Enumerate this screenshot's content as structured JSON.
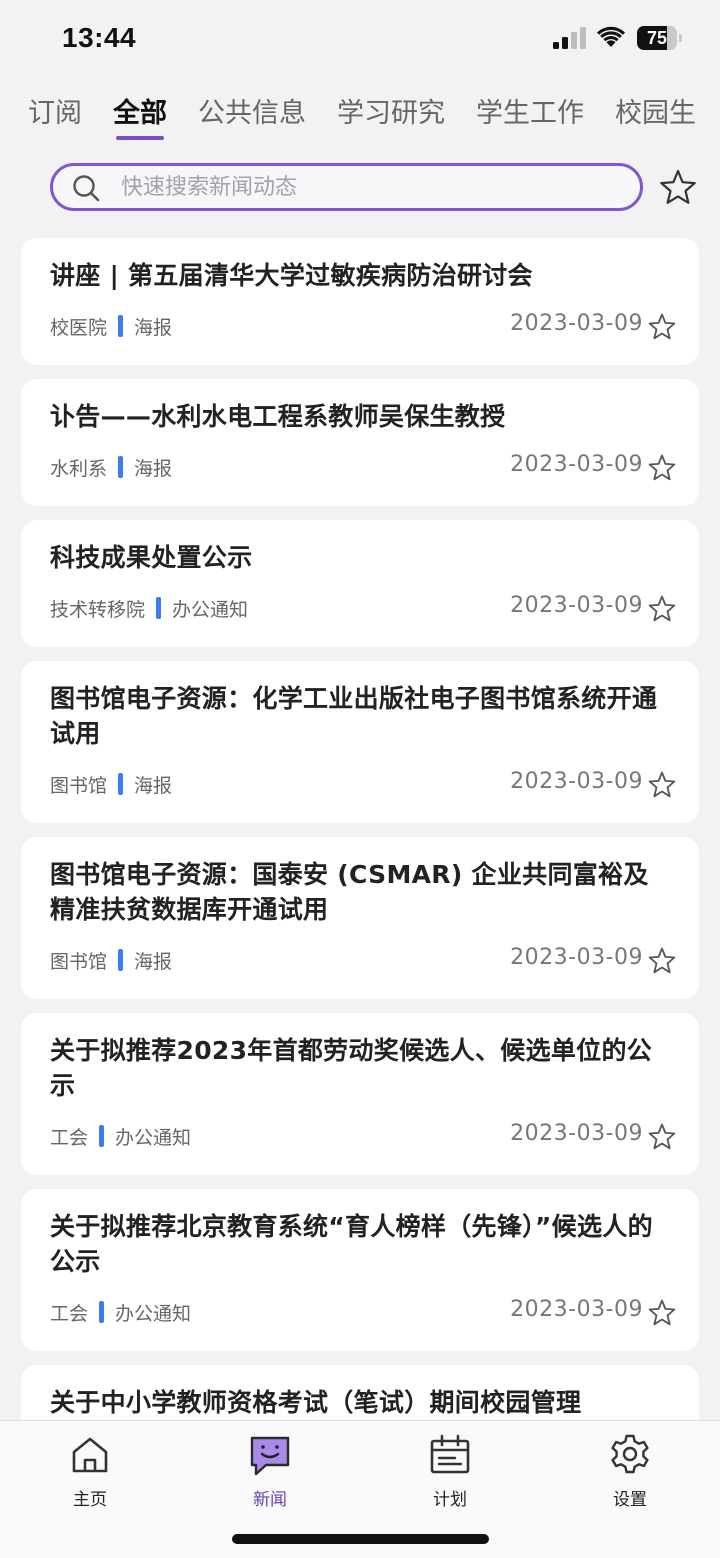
{
  "status": {
    "time": "13:44",
    "battery": "75",
    "battery_level": 0.75
  },
  "tabs": [
    "订阅",
    "全部",
    "公共信息",
    "学习研究",
    "学生工作",
    "校园生"
  ],
  "active_tab": 1,
  "search": {
    "placeholder": "快速搜索新闻动态"
  },
  "news": [
    {
      "title": "讲座 | 第五届清华大学过敏疾病防治研讨会",
      "source": "校医院",
      "type": "海报",
      "date": "2023-03-09"
    },
    {
      "title": "讣告——水利水电工程系教师吴保生教授",
      "source": "水利系",
      "type": "海报",
      "date": "2023-03-09"
    },
    {
      "title": "科技成果处置公示",
      "source": "技术转移院",
      "type": "办公通知",
      "date": "2023-03-09"
    },
    {
      "title": "图书馆电子资源：化学工业出版社电子图书馆系统开通试用",
      "source": "图书馆",
      "type": "海报",
      "date": "2023-03-09"
    },
    {
      "title": "图书馆电子资源：国泰安 (CSMAR) 企业共同富裕及精准扶贫数据库开通试用",
      "source": "图书馆",
      "type": "海报",
      "date": "2023-03-09"
    },
    {
      "title": "关于拟推荐2023年首都劳动奖候选人、候选单位的公示",
      "source": "工会",
      "type": "办公通知",
      "date": "2023-03-09"
    },
    {
      "title": "关于拟推荐北京教育系统“育人榜样（先锋）”候选人的公示",
      "source": "工会",
      "type": "办公通知",
      "date": "2023-03-09"
    },
    {
      "title": "关于中小学教师资格考试（笔试）期间校园管理",
      "source": "",
      "type": "",
      "date": ""
    }
  ],
  "bottom_nav": [
    {
      "label": "主页",
      "icon": "home-icon"
    },
    {
      "label": "新闻",
      "icon": "news-chat-icon",
      "active": true
    },
    {
      "label": "计划",
      "icon": "calendar-icon"
    },
    {
      "label": "设置",
      "icon": "gear-icon"
    }
  ],
  "colors": {
    "accent": "#8256d0",
    "divider": "#3e7bf0",
    "background": "#f2f2f4"
  }
}
